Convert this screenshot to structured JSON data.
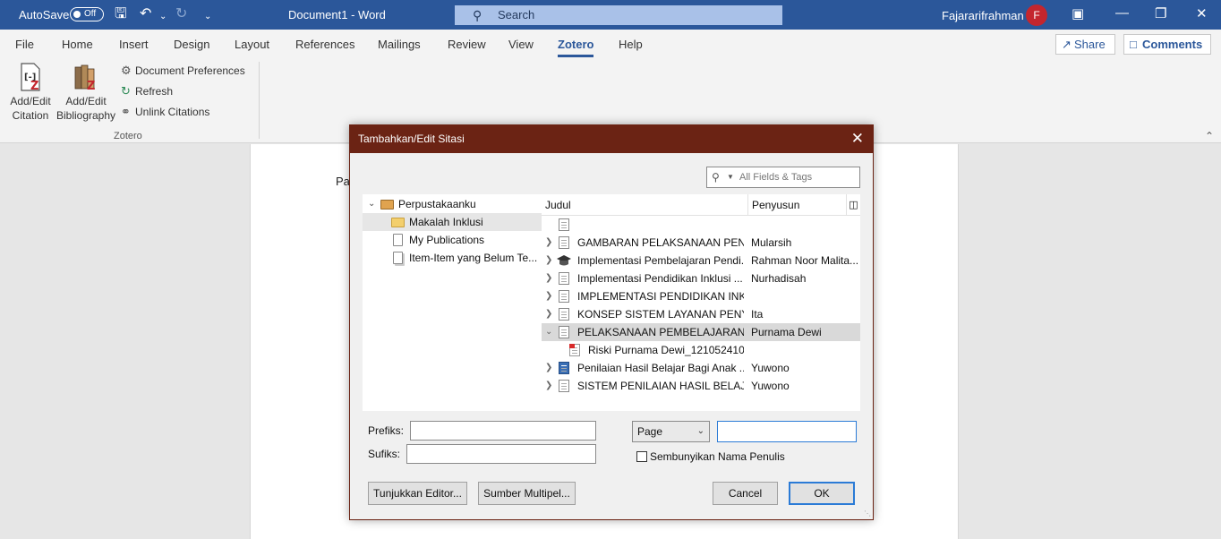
{
  "titlebar": {
    "autosave_label": "AutoSave",
    "autosave_state": "Off",
    "doc_title": "Document1 - Word",
    "search_placeholder": "Search",
    "user_name": "Fajararifrahman",
    "avatar_initial": "F"
  },
  "ribbon": {
    "tabs": [
      "File",
      "Home",
      "Insert",
      "Design",
      "Layout",
      "References",
      "Mailings",
      "Review",
      "View",
      "Zotero",
      "Help"
    ],
    "active_tab": "Zotero",
    "share_label": "Share",
    "comments_label": "Comments",
    "zotero": {
      "add_citation": [
        "Add/Edit",
        "Citation"
      ],
      "add_bibliography": [
        "Add/Edit",
        "Bibliography"
      ],
      "doc_prefs": "Document Preferences",
      "refresh": "Refresh",
      "unlink": "Unlink Citations",
      "group_label": "Zotero"
    }
  },
  "document": {
    "visible_text": "Pa"
  },
  "dialog": {
    "title": "Tambahkan/Edit Sitasi",
    "filter_placeholder": "All Fields & Tags",
    "library": [
      {
        "label": "Perpustakaanku",
        "type": "library",
        "expanded": true
      },
      {
        "label": "Makalah Inklusi",
        "type": "collection",
        "selected": true
      },
      {
        "label": "My Publications",
        "type": "publications"
      },
      {
        "label": "Item-Item yang Belum Te...",
        "type": "unfiled"
      }
    ],
    "columns": {
      "title": "Judul",
      "author": "Penyusun"
    },
    "items": [
      {
        "title": "",
        "author": "",
        "type": "document"
      },
      {
        "title": "GAMBARAN PELAKSANAAN PEN...",
        "author": "Mularsih",
        "type": "document"
      },
      {
        "title": "Implementasi Pembelajaran Pendi...",
        "author": "Rahman Noor Malita...",
        "type": "thesis"
      },
      {
        "title": "Implementasi Pendidikan Inklusi ...",
        "author": "Nurhadisah",
        "type": "document"
      },
      {
        "title": "IMPLEMENTASI PENDIDIKAN INK...",
        "author": "",
        "type": "document"
      },
      {
        "title": "KONSEP SISTEM LAYANAN PENY...",
        "author": "Ita",
        "type": "document"
      },
      {
        "title": "PELAKSANAAN PEMBELAJARAN ...",
        "author": "Purnama Dewi",
        "type": "document",
        "expanded": true,
        "selected": true
      },
      {
        "title": "Riski Purnama Dewi_121052410...",
        "author": "",
        "type": "pdf-attachment"
      },
      {
        "title": "Penilaian Hasil Belajar Bagi Anak ...",
        "author": "Yuwono",
        "type": "book"
      },
      {
        "title": "SISTEM PENILAIAN HASIL BELAJA...",
        "author": "Yuwono",
        "type": "document"
      }
    ],
    "prefix_label": "Prefiks:",
    "suffix_label": "Sufiks:",
    "prefix_value": "",
    "suffix_value": "",
    "locator_type": "Page",
    "locator_value": "",
    "suppress_author_label": "Sembunyikan Nama Penulis",
    "suppress_author_checked": false,
    "show_editor_label": "Tunjukkan Editor...",
    "multiple_sources_label": "Sumber Multipel...",
    "cancel_label": "Cancel",
    "ok_label": "OK"
  }
}
